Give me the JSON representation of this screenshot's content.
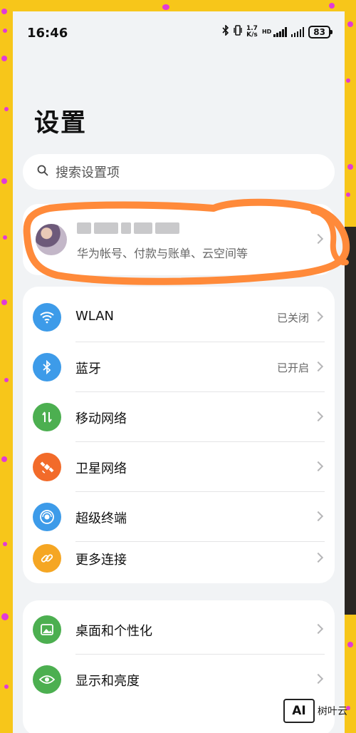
{
  "status_bar": {
    "time": "16:46",
    "speed_value": "1.7",
    "speed_unit": "K/s",
    "battery": "83"
  },
  "page_title": "设置",
  "search": {
    "placeholder": "搜索设置项",
    "icon": "search-icon"
  },
  "account": {
    "subtitle": "华为帐号、付款与账单、云空间等",
    "highlight_color": "#ff8a3a"
  },
  "connectivity": [
    {
      "label": "WLAN",
      "value": "已关闭",
      "icon": "wifi-icon",
      "color": "#3d9be9"
    },
    {
      "label": "蓝牙",
      "value": "已开启",
      "icon": "bluetooth-icon",
      "color": "#3d9be9"
    },
    {
      "label": "移动网络",
      "value": "",
      "icon": "mobile-data-icon",
      "color": "#4caf50"
    },
    {
      "label": "卫星网络",
      "value": "",
      "icon": "satellite-icon",
      "color": "#f26b2a"
    },
    {
      "label": "超级终端",
      "value": "",
      "icon": "super-device-icon",
      "color": "#3d9be9"
    },
    {
      "label": "更多连接",
      "value": "",
      "icon": "link-icon",
      "color": "#f5a623"
    }
  ],
  "display": [
    {
      "label": "桌面和个性化",
      "icon": "wallpaper-icon",
      "color": "#4caf50"
    },
    {
      "label": "显示和亮度",
      "icon": "eye-icon",
      "color": "#4caf50"
    }
  ],
  "watermark": {
    "logo": "AI",
    "text": "树叶云"
  }
}
